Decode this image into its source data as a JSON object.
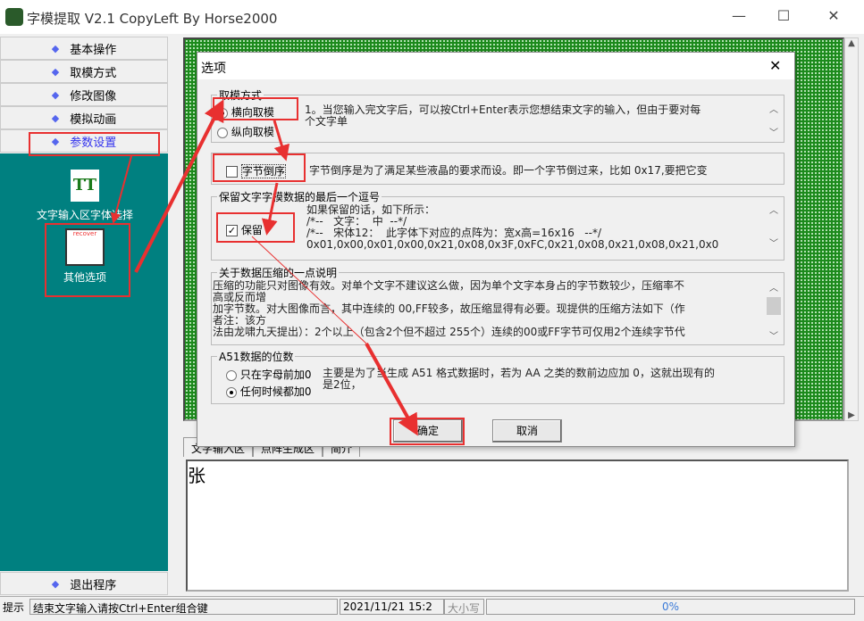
{
  "window": {
    "title": "字模提取 V2.1  CopyLeft By Horse2000",
    "minimize": "—",
    "maximize": "☐",
    "close": "✕"
  },
  "sidebar": {
    "items": [
      {
        "label": "基本操作"
      },
      {
        "label": "取模方式"
      },
      {
        "label": "修改图像"
      },
      {
        "label": "模拟动画"
      },
      {
        "label": "参数设置"
      }
    ],
    "icons": [
      {
        "label": "文字输入区字体选择"
      },
      {
        "label": "其他选项"
      }
    ],
    "exit": "退出程序",
    "accent": "#008080"
  },
  "dialog": {
    "title": "选项",
    "close": "✕",
    "group1": {
      "legend": "取模方式",
      "opt1": "横向取模",
      "opt2": "纵向取模",
      "desc": "1。当您输入完文字后，可以按Ctrl+Enter表示您想结束文字的输入，但由于要对每\n个文字单"
    },
    "group2": {
      "check": "字节倒序",
      "desc": "字节倒序是为了满足某些液晶的要求而设。即一个字节倒过来，比如 0x17,要把它变"
    },
    "group3": {
      "legend": "保留文字字模数据的最后一个逗号",
      "check": "保留",
      "desc": "如果保留的话，如下所示：\n/*--   文字：  中  --*/\n/*--   宋体12：  此字体下对应的点阵为：宽x高=16x16   --*/\n0x01,0x00,0x01,0x00,0x21,0x08,0x3F,0xFC,0x21,0x08,0x21,0x08,0x21,0x0"
    },
    "group4": {
      "legend": "关于数据压缩的一点说明",
      "desc": "压缩的功能只对图像有效。对单个文字不建议这么做，因为单个文字本身占的字节数较少，压缩率不\n高或反而增\n加字节数。对大图像而言，其中连续的 00,FF较多，故压缩显得有必要。现提供的压缩方法如下（作\n者注：该方\n法由龙啸九天提出）：2个以上（包含2个但不超过 255个）连续的00或FF字节可仅用2个连续字节代"
    },
    "group5": {
      "legend": "A51数据的位数",
      "opt1": "只在字母前加0",
      "opt2": "任何时候都加0",
      "desc": "主要是为了当生成 A51 格式数据时，若为 AA 之类的数前边应加 0，这就出现有的\n是2位，"
    },
    "ok": "确定",
    "cancel": "取消"
  },
  "tabs": [
    "文字输入区",
    "点阵生成区",
    "简介"
  ],
  "input_text": "张",
  "statusbar": {
    "label": "提示",
    "hint": "结束文字输入请按Ctrl+Enter组合键",
    "datetime": "2021/11/21 15:2",
    "caps": "大小写",
    "progress": "0%"
  },
  "annotation_color": "#e83030"
}
